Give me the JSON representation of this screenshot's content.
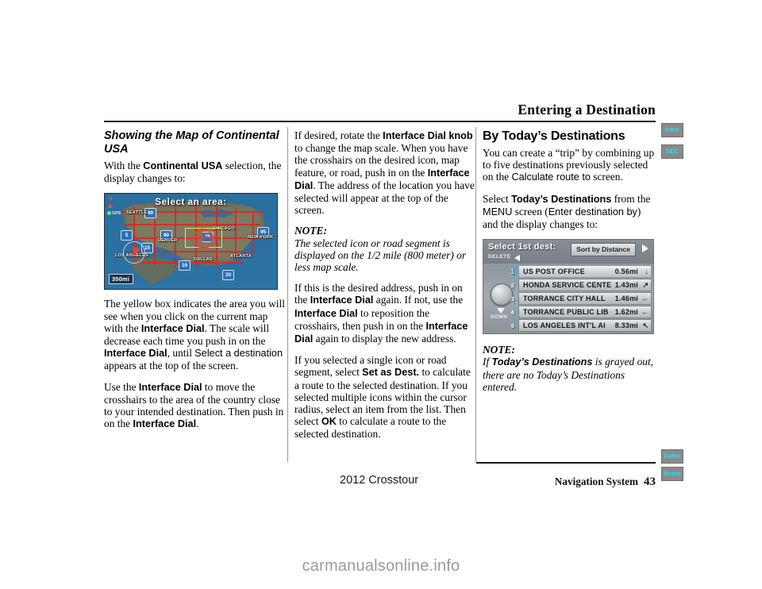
{
  "header": {
    "chapter_title": "Entering a Destination"
  },
  "side_tabs": [
    {
      "label": "Intro",
      "position": "top"
    },
    {
      "label": "SEC",
      "position": "top"
    },
    {
      "label": "Index",
      "position": "bottom"
    },
    {
      "label": "Home",
      "position": "bottom"
    }
  ],
  "colors": {
    "tab_background": "#8a8a8a",
    "tab_text": "#25e0e8",
    "map_yellow_box": "#f5e53a",
    "map_crosshair_red": "#e8432c",
    "nav_selection_blue": "#3fb0ef",
    "watermark_gray": "#9b9b9b"
  },
  "left_column": {
    "heading": "Showing the Map of Continental USA",
    "paragraph_1": {
      "pre": "With the ",
      "bold": "Continental USA",
      "post": " selection, the display changes to:"
    },
    "paragraph_2": {
      "seg1": "The yellow box indicates the area you will see when you click on the current map with the ",
      "bold1": "Interface Dial",
      "seg2": ". The scale will decrease each time you push in on the ",
      "bold2": "Interface Dial",
      "seg3": ", until ",
      "sans1": "Select a destination",
      "seg4": " appears at the top of the screen."
    },
    "paragraph_3": {
      "seg1": "Use the ",
      "bold1": "Interface Dial",
      "seg2": " to move the crosshairs to the area of the country close to your intended destination. Then push in on the ",
      "bold2": "Interface Dial",
      "seg3": "."
    },
    "map_screenshot": {
      "title": "Select an area:",
      "scale": "350mi",
      "north_label": "N",
      "gps_label": "GPS",
      "city_labels": [
        "SEATTLE",
        "DENVER",
        "LOS ANGELES",
        "DALLAS",
        "CHICAGO",
        "NEW YORK",
        "ATLANTA"
      ],
      "highway_shields": [
        "90",
        "5",
        "80",
        "15",
        "10",
        "20",
        "95",
        "75"
      ]
    }
  },
  "middle_column": {
    "paragraph_1": {
      "seg1": "If desired, rotate the ",
      "bold1": "Interface Dial knob",
      "seg2": " to change the map scale. When you have the crosshairs on the desired icon, map feature, or road, push in on the ",
      "bold2": "Interface Dial",
      "seg3": ". The address of the location you have selected will appear at the top of the screen."
    },
    "note_label": "NOTE:",
    "note_text": "The selected icon or road segment is displayed on the 1/2 mile (800 meter) or less map scale.",
    "paragraph_2": {
      "seg1": "If this is the desired address, push in on the ",
      "bold1": "Interface Dial",
      "seg2": " again. If not, use the ",
      "bold2": "Interface Dial",
      "seg3": " to reposition the crosshairs, then push in on the ",
      "bold3": "Interface Dial",
      "seg4": " again to display the new address."
    },
    "paragraph_3": {
      "seg1": "If you selected a single icon or road segment, select ",
      "bold1": "Set as Dest.",
      "seg2": " to calculate a route to the selected destination. If you selected multiple icons within the cursor radius, select an item from the list. Then select ",
      "bold2": "OK",
      "seg3": " to calculate a route to the selected destination."
    }
  },
  "right_column": {
    "heading": "By Today’s Destinations",
    "paragraph_1": {
      "seg1": "You can create a “trip” by combining up to five destinations previously selected on the ",
      "sans1": "Calculate route to",
      "seg2": " screen."
    },
    "paragraph_2": {
      "seg1": "Select ",
      "bold1": "Today’s Destinations",
      "seg2": " from the ",
      "sans1": "MENU",
      "seg3": " screen (",
      "sans2": "Enter destination by",
      "seg4": ") and the display changes to:"
    },
    "note_label": "NOTE:",
    "note": {
      "seg1": "If ",
      "bold1": "Today’s Destinations",
      "seg2": " is grayed out, there are no Today’s Destinations entered."
    },
    "nav_screenshot": {
      "title": "Select 1st dest:",
      "sort_button": "Sort by Distance",
      "delete_label": "DELETE",
      "down_label": "DOWN",
      "rows": [
        {
          "index": "1",
          "name": "US POST OFFICE",
          "distance": "0.56mi",
          "direction": "↓",
          "selected": true
        },
        {
          "index": "2",
          "name": "HONDA SERVICE CENTE",
          "distance": "1.43mi",
          "direction": "↗",
          "selected": false
        },
        {
          "index": "3",
          "name": "TORRANCE CITY HALL",
          "distance": "1.46mi",
          "direction": "←",
          "selected": false
        },
        {
          "index": "4",
          "name": "TORRANCE PUBLIC LIB",
          "distance": "1.62mi",
          "direction": "←",
          "selected": false
        },
        {
          "index": "5",
          "name": "LOS ANGELES INT'L AI",
          "distance": "8.33mi",
          "direction": "↖",
          "selected": false
        }
      ]
    }
  },
  "footer": {
    "model": "2012 Crosstour",
    "system": "Navigation System",
    "page_number": "43"
  },
  "watermark": "carmanualsonline.info"
}
